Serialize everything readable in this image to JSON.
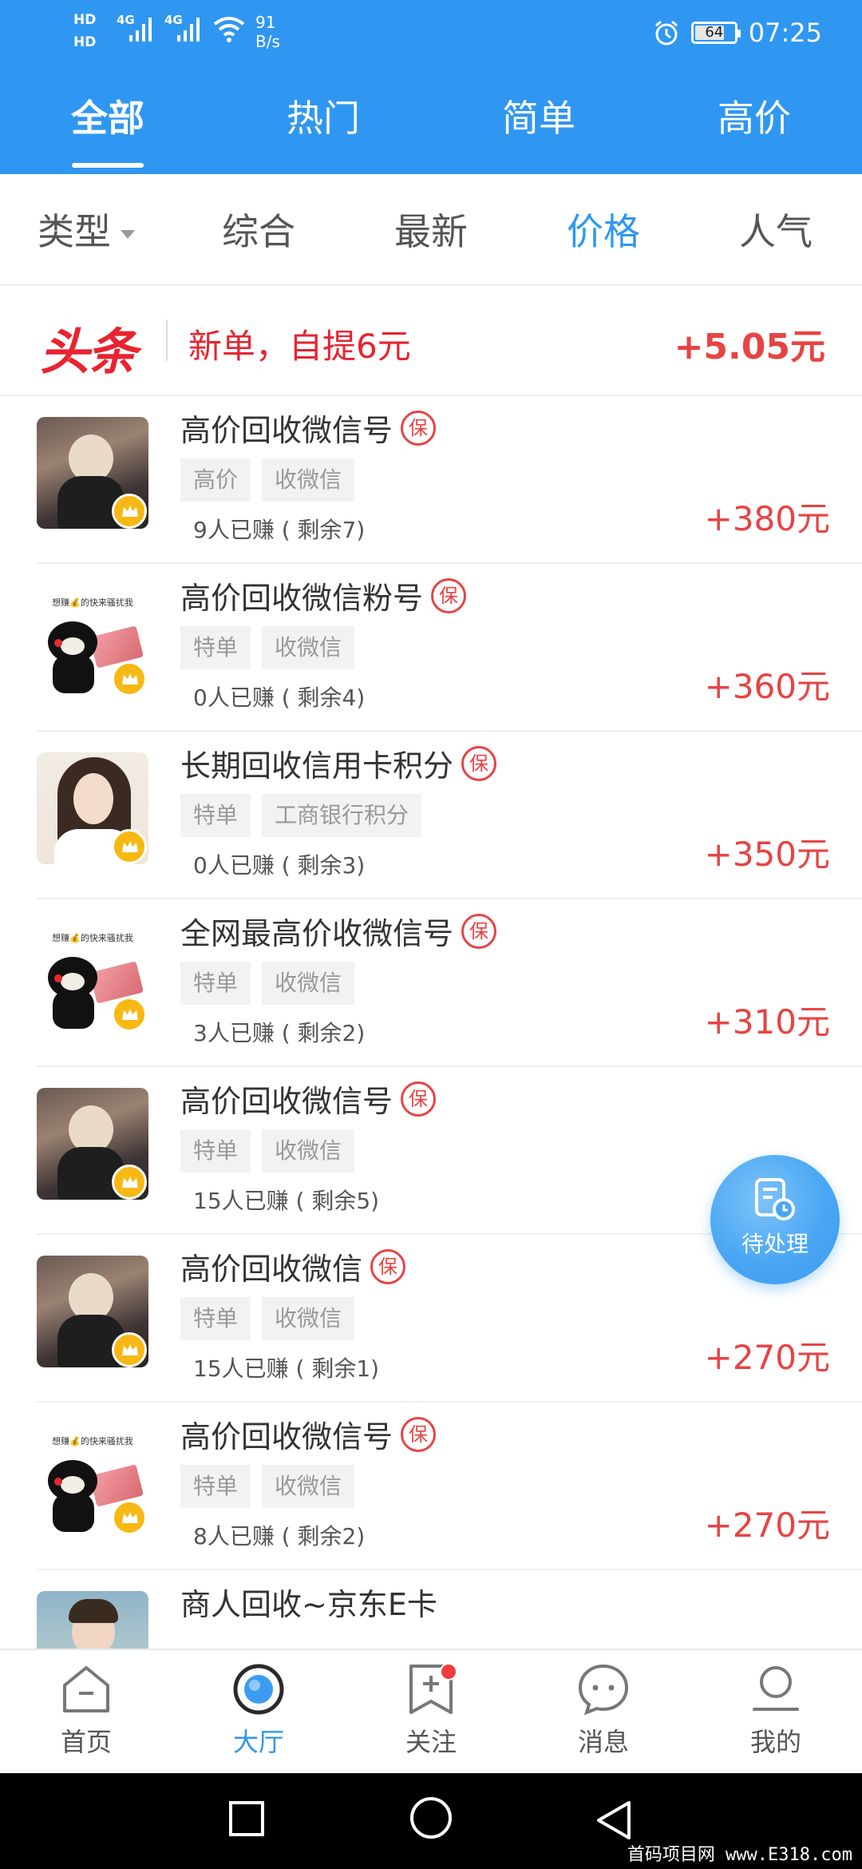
{
  "status_bar": {
    "hd1": "HD",
    "hd2": "HD",
    "net1": "4G",
    "net2": "4G",
    "speed_value": "91",
    "speed_unit": "B/s",
    "battery": "64",
    "time": "07:25"
  },
  "top_tabs": [
    "全部",
    "热门",
    "简单",
    "高价"
  ],
  "top_tab_active_index": 0,
  "sort_bar": {
    "items": [
      "类型",
      "综合",
      "最新",
      "价格",
      "人气"
    ],
    "active_index": 3
  },
  "headline": {
    "logo": "头条",
    "text": "新单，自提6元",
    "amount": "+5.05元"
  },
  "guarantee_badge": "保",
  "list": [
    {
      "title": "高价回收微信号",
      "tags": [
        "高价",
        "收微信"
      ],
      "stats": "9人已赚 ( 剩余7)",
      "amount": "+380元",
      "avatar": "photo"
    },
    {
      "title": "高价回收微信粉号",
      "tags": [
        "特单",
        "收微信"
      ],
      "stats": "0人已赚 ( 剩余4)",
      "amount": "+360元",
      "avatar": "bear"
    },
    {
      "title": "长期回收信用卡积分",
      "tags": [
        "特单",
        "工商银行积分"
      ],
      "stats": "0人已赚 ( 剩余3)",
      "amount": "+350元",
      "avatar": "girl"
    },
    {
      "title": "全网最高价收微信号",
      "tags": [
        "特单",
        "收微信"
      ],
      "stats": "3人已赚 ( 剩余2)",
      "amount": "+310元",
      "avatar": "bear"
    },
    {
      "title": "高价回收微信号",
      "tags": [
        "特单",
        "收微信"
      ],
      "stats": "15人已赚 ( 剩余5)",
      "amount": "",
      "avatar": "photo"
    },
    {
      "title": "高价回收微信",
      "tags": [
        "特单",
        "收微信"
      ],
      "stats": "15人已赚 ( 剩余1)",
      "amount": "+270元",
      "avatar": "photo"
    },
    {
      "title": "高价回收微信号",
      "tags": [
        "特单",
        "收微信"
      ],
      "stats": "8人已赚 ( 剩余2)",
      "amount": "+270元",
      "avatar": "bear"
    },
    {
      "title": "商人回收~京东E卡",
      "tags": [],
      "stats": "",
      "amount": "",
      "avatar": "boy"
    }
  ],
  "bear_caption": "想赚💰的快来骚扰我",
  "fab": {
    "label": "待处理"
  },
  "bottom_nav": {
    "items": [
      "首页",
      "大厅",
      "关注",
      "消息",
      "我的"
    ],
    "active_index": 1
  },
  "watermark": "首码项目网 www.E318.com",
  "colors": {
    "primary": "#2f97f1",
    "price_red": "#e84343",
    "headline_red": "#e8232f"
  }
}
